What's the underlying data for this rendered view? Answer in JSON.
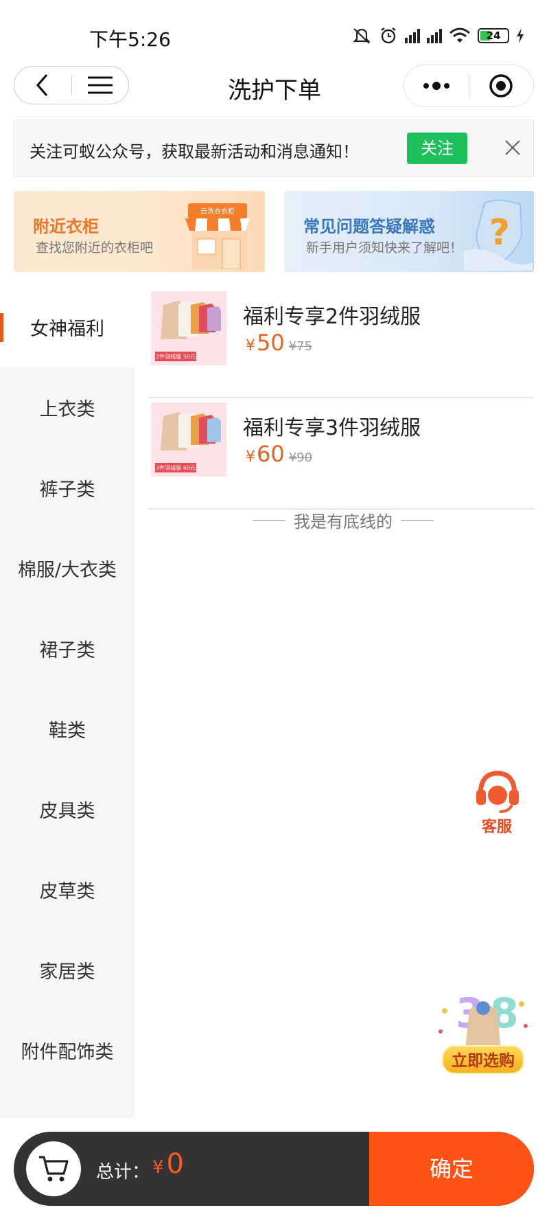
{
  "status_bar": {
    "time": "下午5:26",
    "battery": "24"
  },
  "nav": {
    "title": "洗护下单"
  },
  "follow_banner": {
    "text": "关注可蚁公众号，获取最新活动和消息通知！",
    "button": "关注"
  },
  "promos": [
    {
      "title": "附近衣柜",
      "subtitle": "查找您附近的衣柜吧",
      "sign": "云洗衣衣柜"
    },
    {
      "title": "常见问题答疑解惑",
      "subtitle": "新手用户须知快来了解吧！"
    }
  ],
  "categories": [
    {
      "label": "女神福利",
      "active": true
    },
    {
      "label": "上衣类"
    },
    {
      "label": "裤子类"
    },
    {
      "label": "棉服/大衣类"
    },
    {
      "label": "裙子类"
    },
    {
      "label": "鞋类"
    },
    {
      "label": "皮具类"
    },
    {
      "label": "皮草类"
    },
    {
      "label": "家居类"
    },
    {
      "label": "附件配饰类"
    }
  ],
  "products": [
    {
      "name": "福利专享2件羽绒服",
      "currency": "¥",
      "price": "50",
      "old_price": "¥75",
      "thumb_tag": "2件羽绒服 50元"
    },
    {
      "name": "福利专享3件羽绒服",
      "currency": "¥",
      "price": "60",
      "old_price": "¥90",
      "thumb_tag": "3件羽绒服 60元"
    }
  ],
  "bottom_line": "我是有底线的",
  "service_label": "客服",
  "buy_now_label": "立即选购",
  "cart": {
    "total_label": "总计：",
    "currency": "¥",
    "total": "0",
    "confirm": "确定"
  },
  "colors": {
    "accent": "#ff5316",
    "follow_green": "#1ec05c",
    "price": "#e8621c"
  }
}
